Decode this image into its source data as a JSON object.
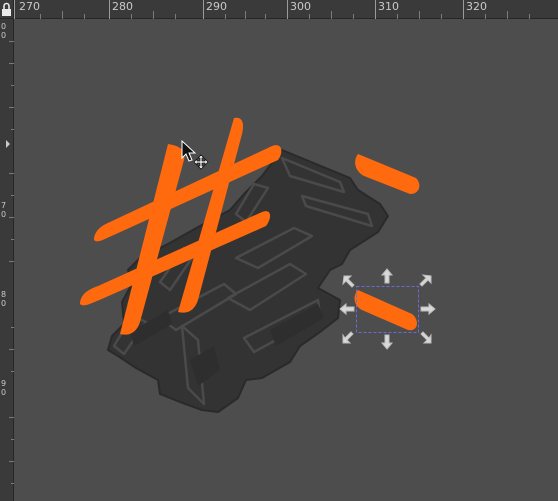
{
  "ruler": {
    "horizontal": [
      "270",
      "280",
      "290",
      "300",
      "310",
      "320"
    ],
    "vertical": [
      "0",
      "0",
      "7",
      "0",
      "8",
      "0",
      "9",
      "0"
    ]
  },
  "colors": {
    "accent": "#ff6a0e",
    "shadow": "#333333",
    "canvas": "#4d4d4d",
    "ruler": "#3a3a3a"
  },
  "icons": {
    "lock": "lock-icon",
    "cursor": "pointer-cursor-icon",
    "move": "move-cursor-icon"
  }
}
